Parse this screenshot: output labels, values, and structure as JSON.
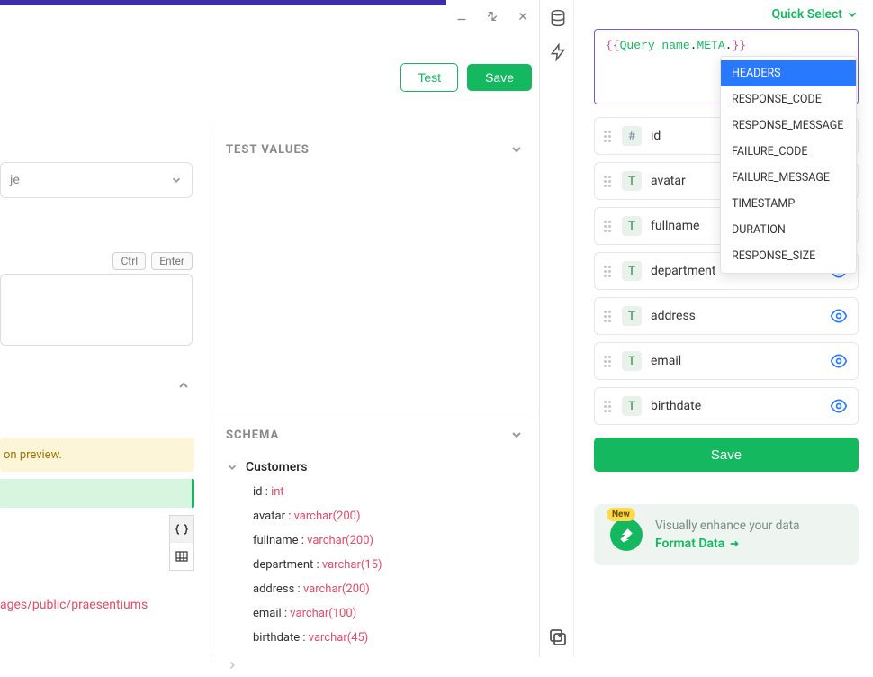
{
  "window": {
    "minimize": "–",
    "maximize": "⤢",
    "close": "✕"
  },
  "toolbar": {
    "test_label": "Test",
    "save_label": "Save"
  },
  "left": {
    "select_placeholder": "je",
    "key_hint_ctrl": "Ctrl",
    "key_hint_enter": "Enter",
    "warning_text": "on preview.",
    "frag_link": "ages/public/praesentiums"
  },
  "sections": {
    "test_values": "TEST VALUES",
    "schema": "SCHEMA"
  },
  "schema": {
    "table_name": "Customers",
    "columns": [
      {
        "name": "id",
        "type": "int"
      },
      {
        "name": "avatar",
        "type": "varchar(200)"
      },
      {
        "name": "fullname",
        "type": "varchar(200)"
      },
      {
        "name": "department",
        "type": "varchar(15)"
      },
      {
        "name": "address",
        "type": "varchar(200)"
      },
      {
        "name": "email",
        "type": "varchar(100)"
      },
      {
        "name": "birthdate",
        "type": "varchar(45)"
      }
    ]
  },
  "right": {
    "quick_select_label": "Quick Select",
    "expr_prefix": "{{",
    "expr_obj": "Query_name",
    "expr_meta": "META",
    "expr_suffix": "}}",
    "save_label": "Save"
  },
  "autocomplete": {
    "items": [
      "HEADERS",
      "RESPONSE_CODE",
      "RESPONSE_MESSAGE",
      "FAILURE_CODE",
      "FAILURE_MESSAGE",
      "TIMESTAMP",
      "DURATION",
      "RESPONSE_SIZE"
    ],
    "selected_index": 0
  },
  "fields": [
    {
      "icon": "#",
      "label": "id",
      "eye": false
    },
    {
      "icon": "T",
      "label": "avatar",
      "eye": false
    },
    {
      "icon": "T",
      "label": "fullname",
      "eye": false
    },
    {
      "icon": "T",
      "label": "department",
      "eye": true
    },
    {
      "icon": "T",
      "label": "address",
      "eye": true
    },
    {
      "icon": "T",
      "label": "email",
      "eye": true
    },
    {
      "icon": "T",
      "label": "birthdate",
      "eye": true
    }
  ],
  "promo": {
    "new_badge": "New",
    "title": "Visually enhance your data",
    "link": "Format Data"
  }
}
